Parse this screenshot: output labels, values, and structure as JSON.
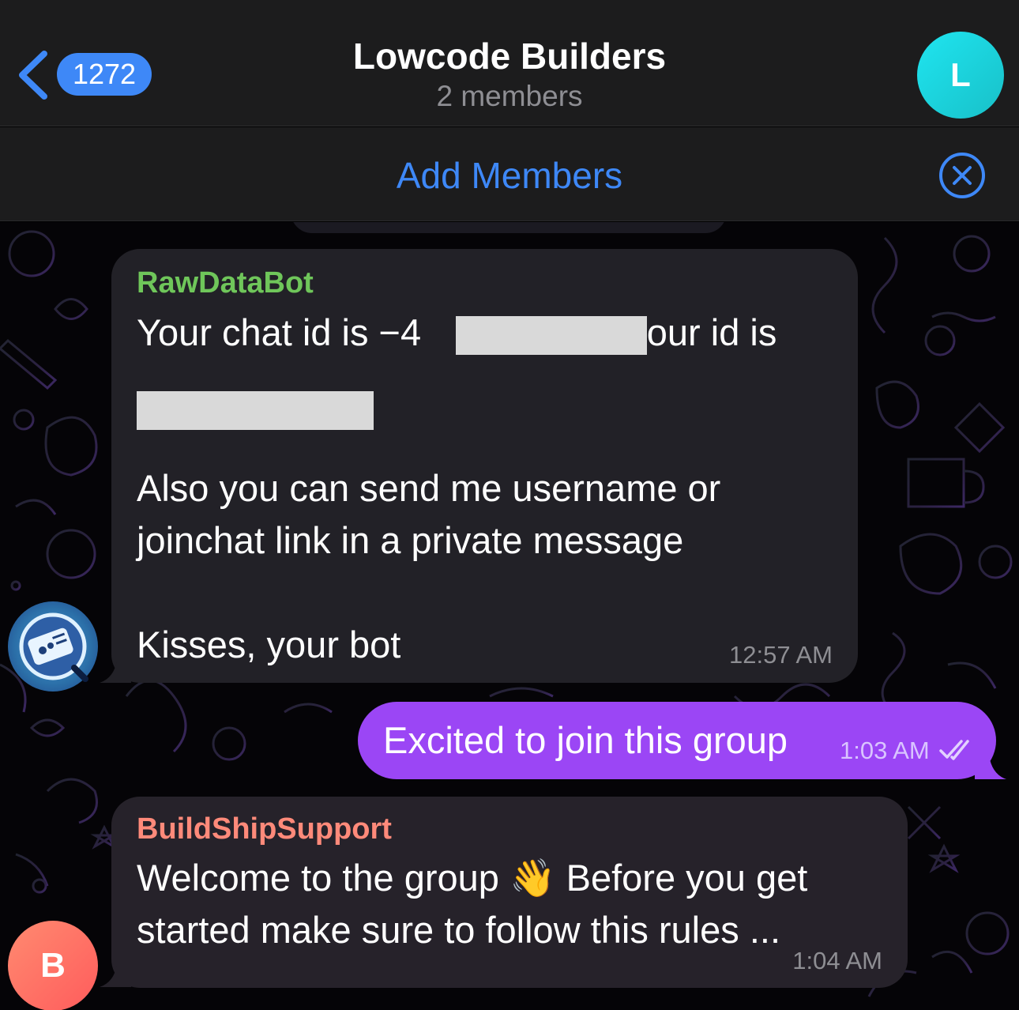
{
  "header": {
    "unread_count": "1272",
    "title": "Lowcode Builders",
    "subtitle": "2 members",
    "avatar_letter": "L",
    "avatar_color": "#1fdbe6"
  },
  "add_members": {
    "label": "Add Members"
  },
  "messages": [
    {
      "sender": "RawDataBot",
      "sender_color": "#6fc65a",
      "line1_prefix": "Your chat id is −4",
      "line1_suffix": ", your id is",
      "body": "Also you can send me username or\njoinchat link in a private message\n\nKisses, your bot",
      "time": "12:57 AM"
    },
    {
      "text": "Excited to join this group",
      "time": "1:03 AM",
      "status_icon": "double-check-icon",
      "bubble_color": "#9b46f5"
    },
    {
      "sender": "BuildShipSupport",
      "sender_color": "#ff8a7a",
      "line1": "Welcome to the group",
      "emoji": "👋",
      "line1_after": "Before you get",
      "line2": "started make sure to follow this rules ...",
      "time": "1:04 AM",
      "avatar_letter": "B"
    }
  ]
}
